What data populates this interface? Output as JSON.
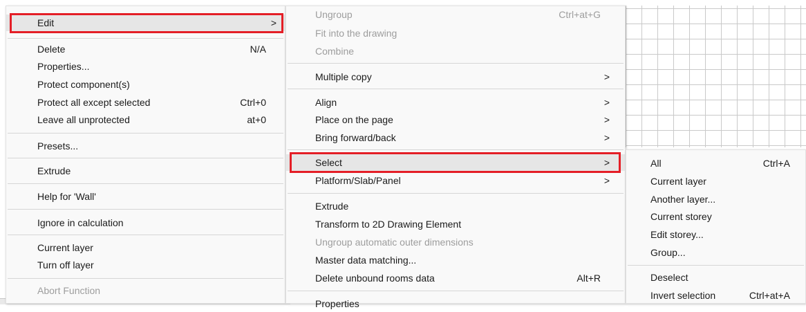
{
  "colors": {
    "highlight_border": "#e41e26",
    "menu_bg": "#f9f9f9",
    "disabled_text": "#9d9d9d"
  },
  "menu1": {
    "edit": {
      "label": "Edit",
      "arrow": ">"
    },
    "delete": {
      "label": "Delete",
      "shortcut": "N/A"
    },
    "properties": {
      "label": "Properties..."
    },
    "protect_components": {
      "label": "Protect component(s)"
    },
    "protect_all_except": {
      "label": "Protect all except selected",
      "shortcut": "Ctrl+0"
    },
    "leave_unprotected": {
      "label": "Leave all unprotected",
      "shortcut": "at+0"
    },
    "presets": {
      "label": "Presets..."
    },
    "extrude": {
      "label": "Extrude"
    },
    "help_wall": {
      "label": "Help for 'Wall'"
    },
    "ignore_calc": {
      "label": "Ignore in calculation"
    },
    "current_layer": {
      "label": "Current layer"
    },
    "turn_off_layer": {
      "label": "Turn off layer"
    },
    "abort_function": {
      "label": "Abort Function"
    }
  },
  "menu2": {
    "ungroup": {
      "label": "Ungroup",
      "shortcut": "Ctrl+at+G"
    },
    "fit_drawing": {
      "label": "Fit into the drawing"
    },
    "combine": {
      "label": "Combine"
    },
    "multiple_copy": {
      "label": "Multiple copy",
      "arrow": ">"
    },
    "align": {
      "label": "Align",
      "arrow": ">"
    },
    "place_on_page": {
      "label": "Place on the page",
      "arrow": ">"
    },
    "bring_forward": {
      "label": "Bring forward/back",
      "arrow": ">"
    },
    "select": {
      "label": "Select",
      "arrow": ">"
    },
    "platform": {
      "label": "Platform/Slab/Panel",
      "arrow": ">"
    },
    "extrude": {
      "label": "Extrude"
    },
    "transform_2d": {
      "label": "Transform to 2D Drawing Element"
    },
    "ungroup_auto": {
      "label": "Ungroup automatic outer dimensions"
    },
    "master_data": {
      "label": "Master data matching..."
    },
    "delete_unbound": {
      "label": "Delete unbound rooms data",
      "shortcut": "Alt+R"
    },
    "properties": {
      "label": "Properties"
    }
  },
  "menu3": {
    "all": {
      "label": "All",
      "shortcut": "Ctrl+A"
    },
    "current_layer": {
      "label": "Current layer"
    },
    "another_layer": {
      "label": "Another layer..."
    },
    "current_storey": {
      "label": "Current storey"
    },
    "edit_storey": {
      "label": "Edit storey..."
    },
    "group": {
      "label": "Group..."
    },
    "deselect": {
      "label": "Deselect"
    },
    "invert_selection": {
      "label": "Invert selection",
      "shortcut": "Ctrl+at+A"
    }
  }
}
